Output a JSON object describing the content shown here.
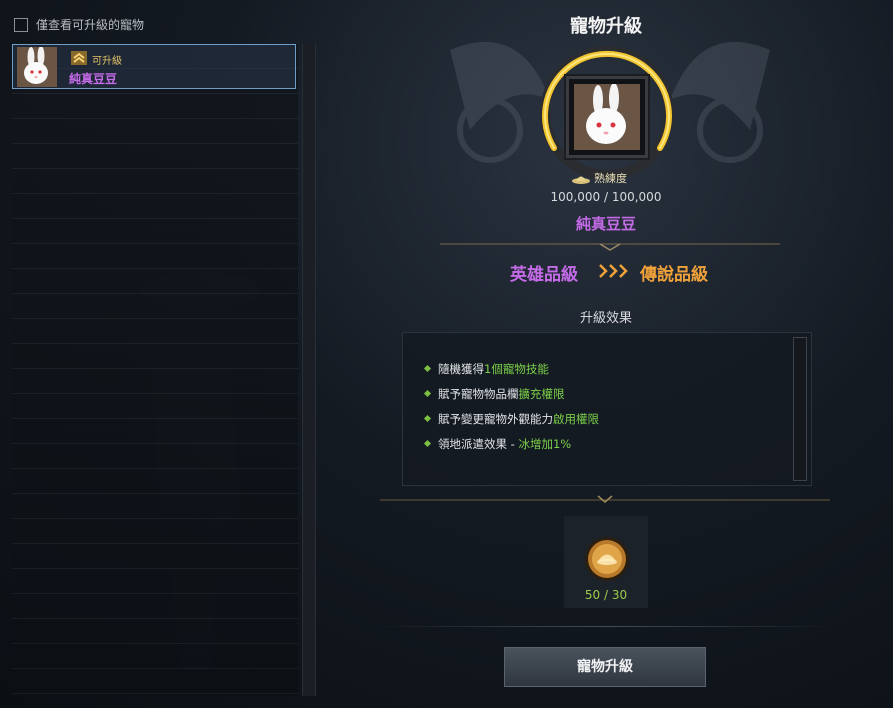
{
  "filter": {
    "label": "僅查看可升級的寵物",
    "checked": false
  },
  "pet_list": [
    {
      "badge_label": "可升級",
      "name": "純真豆豆",
      "selected": true
    }
  ],
  "panel": {
    "title": "寵物升級",
    "proficiency_label": "熟練度",
    "proficiency_value": "100,000 / 100,000",
    "pet_name": "純真豆豆",
    "grade_from": "英雄品級",
    "grade_to": "傳說品級",
    "effects_title": "升級效果",
    "effects": [
      {
        "prefix": "隨機獲得",
        "highlight": "1個寵物技能",
        "suffix": ""
      },
      {
        "prefix": "賦予寵物物品欄",
        "highlight": "擴充權限",
        "suffix": ""
      },
      {
        "prefix": "賦予變更寵物外觀能力",
        "highlight": "啟用權限",
        "suffix": ""
      },
      {
        "prefix": "領地派遣效果 - ",
        "highlight": "冰增加1%",
        "suffix": ""
      }
    ],
    "material_count": "50 / 30",
    "upgrade_button": "寵物升級"
  },
  "colors": {
    "heroic": "#c46be8",
    "legendary": "#f0a23a",
    "effect_highlight": "#7bd04a",
    "selection_border": "#6f9fc7"
  },
  "icons": [
    "checkbox",
    "rabbit-pet-icon",
    "upgrade-chevron-icon",
    "hat-icon",
    "triple-arrow-icon",
    "gold-medal-icon"
  ]
}
